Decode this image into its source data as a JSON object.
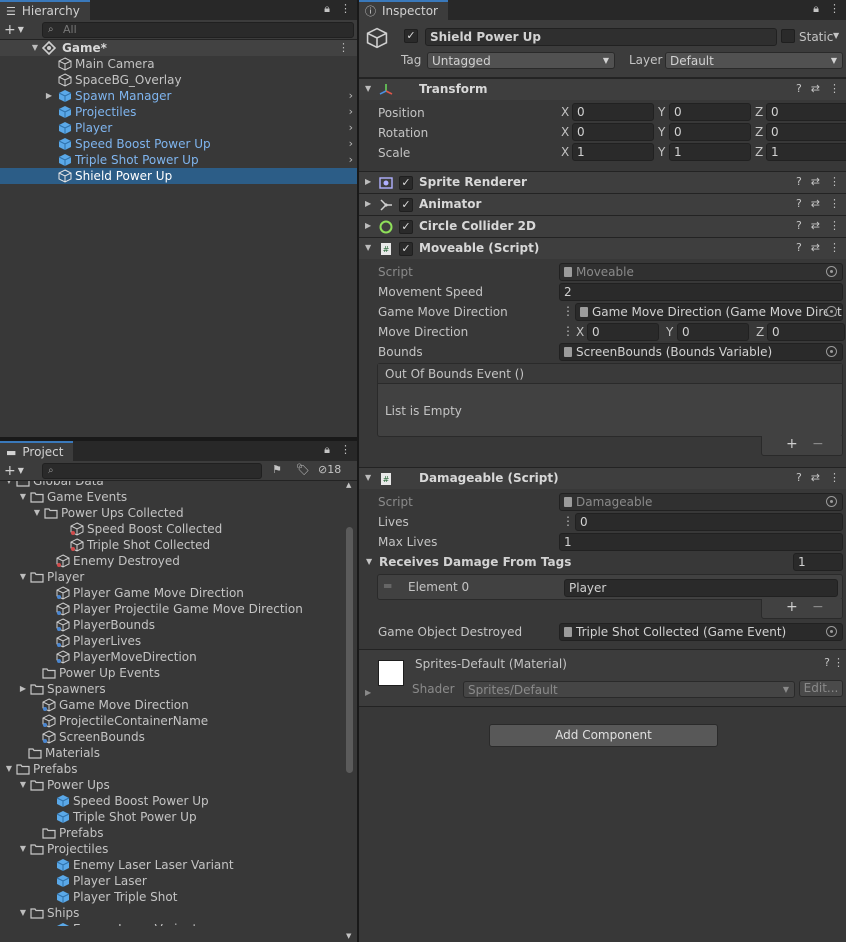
{
  "hierarchy": {
    "tab_label": "Hierarchy",
    "search_placeholder": "All",
    "scene": "Game*",
    "items": [
      {
        "label": "Main Camera"
      },
      {
        "label": "SpaceBG_Overlay"
      },
      {
        "label": "Spawn Manager"
      },
      {
        "label": "Projectiles"
      },
      {
        "label": "Player"
      },
      {
        "label": "Speed Boost Power Up"
      },
      {
        "label": "Triple Shot Power Up"
      },
      {
        "label": "Shield Power Up"
      }
    ]
  },
  "project": {
    "tab_label": "Project",
    "hidden_count": "18",
    "items": [
      {
        "label": "Global Data"
      },
      {
        "label": "Game Events"
      },
      {
        "label": "Power Ups Collected"
      },
      {
        "label": "Speed Boost Collected"
      },
      {
        "label": "Triple Shot Collected"
      },
      {
        "label": "Enemy Destroyed"
      },
      {
        "label": "Player"
      },
      {
        "label": "Player Game Move Direction"
      },
      {
        "label": "Player Projectile Game Move Direction"
      },
      {
        "label": "PlayerBounds"
      },
      {
        "label": "PlayerLives"
      },
      {
        "label": "PlayerMoveDirection"
      },
      {
        "label": "Power Up Events"
      },
      {
        "label": "Spawners"
      },
      {
        "label": "Game Move Direction"
      },
      {
        "label": "ProjectileContainerName"
      },
      {
        "label": "ScreenBounds"
      },
      {
        "label": "Materials"
      },
      {
        "label": "Prefabs"
      },
      {
        "label": "Power Ups"
      },
      {
        "label": "Speed Boost Power Up"
      },
      {
        "label": "Triple Shot Power Up"
      },
      {
        "label": "Prefabs"
      },
      {
        "label": "Projectiles"
      },
      {
        "label": "Enemy Laser Laser Variant"
      },
      {
        "label": "Player Laser"
      },
      {
        "label": "Player Triple Shot"
      },
      {
        "label": "Ships"
      },
      {
        "label": "Enemy Laser Variant"
      }
    ]
  },
  "inspector": {
    "tab_label": "Inspector",
    "object_name": "Shield Power Up",
    "static_label": "Static",
    "tag_label": "Tag",
    "tag_value": "Untagged",
    "layer_label": "Layer",
    "layer_value": "Default",
    "transform": {
      "title": "Transform",
      "position_label": "Position",
      "rotation_label": "Rotation",
      "scale_label": "Scale",
      "position": {
        "x": "0",
        "y": "0",
        "z": "0"
      },
      "rotation": {
        "x": "0",
        "y": "0",
        "z": "0"
      },
      "scale": {
        "x": "1",
        "y": "1",
        "z": "1"
      }
    },
    "sprite_renderer": "Sprite Renderer",
    "animator": "Animator",
    "circle_collider": "Circle Collider 2D",
    "moveable": {
      "title": "Moveable (Script)",
      "script_label": "Script",
      "script_value": "Moveable",
      "speed_label": "Movement Speed",
      "speed_value": "2",
      "gmd_label": "Game Move Direction",
      "gmd_value": "Game Move Direction (Game Move Direct",
      "md_label": "Move Direction",
      "md": {
        "x": "0",
        "y": "0",
        "z": "0"
      },
      "bounds_label": "Bounds",
      "bounds_value": "ScreenBounds (Bounds Variable)",
      "event_label": "Out Of Bounds Event ()",
      "empty_label": "List is Empty"
    },
    "damageable": {
      "title": "Damageable (Script)",
      "script_label": "Script",
      "script_value": "Damageable",
      "lives_label": "Lives",
      "lives_value": "0",
      "maxlives_label": "Max Lives",
      "maxlives_value": "1",
      "tags_label": "Receives Damage From Tags",
      "tags_count": "1",
      "element_label": "Element 0",
      "element_value": "Player",
      "destroyed_label": "Game Object Destroyed",
      "destroyed_value": "Triple Shot Collected (Game Event)"
    },
    "material": {
      "name": "Sprites-Default (Material)",
      "shader_label": "Shader",
      "shader_value": "Sprites/Default",
      "edit_label": "Edit..."
    },
    "add_component": "Add Component"
  },
  "axis_labels": {
    "x": "X",
    "y": "Y",
    "z": "Z"
  },
  "colors": {
    "accent": "#3a79bb",
    "selection": "#2c5d87",
    "prefab_text": "#7fb5ef",
    "panel": "#383838"
  }
}
